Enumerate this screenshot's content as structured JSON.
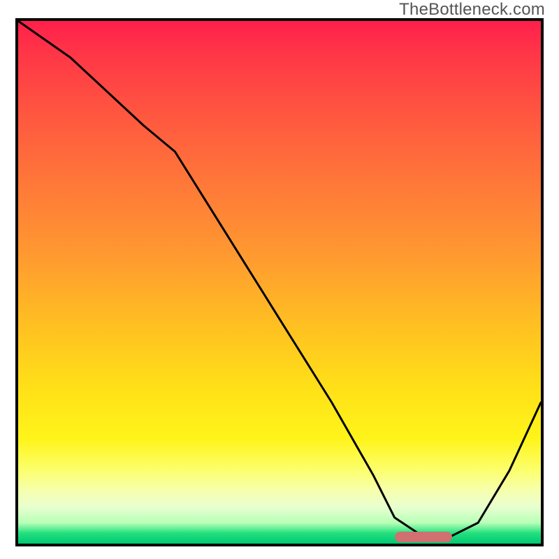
{
  "watermark": "TheBottleneck.com",
  "chart_data": {
    "type": "line",
    "title": "",
    "xlabel": "",
    "ylabel": "",
    "xlim": [
      0,
      100
    ],
    "ylim": [
      0,
      100
    ],
    "series": [
      {
        "name": "curve",
        "x": [
          0,
          10,
          24,
          30,
          40,
          50,
          60,
          68,
          72,
          78,
          82,
          88,
          94,
          100
        ],
        "values": [
          100,
          93,
          80,
          75,
          59,
          43,
          27,
          13,
          5,
          1,
          1,
          4,
          14,
          27
        ]
      }
    ],
    "marker": {
      "x_start": 72,
      "x_end": 83,
      "y": 1
    },
    "gradient_description": "vertical red-to-green heat gradient (red=high bottleneck, green=low)"
  }
}
